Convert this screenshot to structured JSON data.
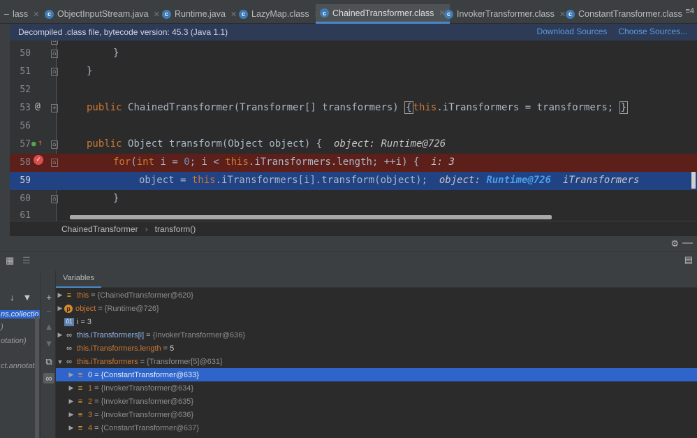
{
  "tabs": [
    {
      "label": "lass",
      "active": false
    },
    {
      "label": "ObjectInputStream.java",
      "active": false
    },
    {
      "label": "Runtime.java",
      "active": false
    },
    {
      "label": "LazyMap.class",
      "active": false
    },
    {
      "label": "ChainedTransformer.class",
      "active": true
    },
    {
      "label": "InvokerTransformer.class",
      "active": false
    },
    {
      "label": "ConstantTransformer.class",
      "active": false
    }
  ],
  "tabs_more": "≡4",
  "banner": {
    "text": "Decompiled .class file, bytecode version: 45.3 (Java 1.1)",
    "download_sources": "Download Sources",
    "choose_sources": "Choose Sources..."
  },
  "editor": {
    "line_numbers": [
      "50",
      "51",
      "52",
      "53",
      "56",
      "57",
      "58",
      "59",
      "60",
      "61"
    ],
    "line50": "}",
    "line51": "}",
    "line53": {
      "kw_public": "public",
      "sig": "ChainedTransformer(Transformer[] transformers)",
      "brace_open": "{",
      "kw_this": "this",
      "body": ".iTransformers = transformers;",
      "brace_close": "}"
    },
    "line57": {
      "kw_public": "public",
      "sig": "Object transform(Object object) {",
      "hint": "object: Runtime@726"
    },
    "line58": {
      "kw_for": "for",
      "paren": "(",
      "kw_int": "int",
      "i_eq": "i = ",
      "zero": "0",
      "cond": "; i < ",
      "kw_this": "this",
      "rest": ".iTransformers.length; ++i) {",
      "hint": "i: 3"
    },
    "line59": {
      "pre": "object = ",
      "kw_this": "this",
      "rest": ".iTransformers[i].transform(object);",
      "hint_label": "object:",
      "hint_value": "Runtime@726",
      "hint_more": "iTransformers"
    },
    "line60": "}"
  },
  "breadcrumb": [
    "ChainedTransformer",
    "transform()"
  ],
  "frames": {
    "items": [
      "ns.collectio",
      ")",
      "otation)",
      "ct.annotati"
    ]
  },
  "variables": {
    "tab_label": "Variables",
    "rows": [
      {
        "name": "this",
        "value": "{ChainedTransformer@620}"
      },
      {
        "name": "object",
        "value": "{Runtime@726}"
      },
      {
        "name": "i",
        "value": "3"
      },
      {
        "name": "this.iTransformers[i]",
        "value": "{InvokerTransformer@636}"
      },
      {
        "name": "this.iTransformers.length",
        "value": "5"
      },
      {
        "name": "this.iTransformers",
        "value": "{Transformer[5]@631}"
      },
      {
        "name": "0",
        "value": "{ConstantTransformer@633}"
      },
      {
        "name": "1",
        "value": "{InvokerTransformer@634}"
      },
      {
        "name": "2",
        "value": "{InvokerTransformer@635}"
      },
      {
        "name": "3",
        "value": "{InvokerTransformer@636}"
      },
      {
        "name": "4",
        "value": "{ConstantTransformer@637}"
      }
    ]
  }
}
